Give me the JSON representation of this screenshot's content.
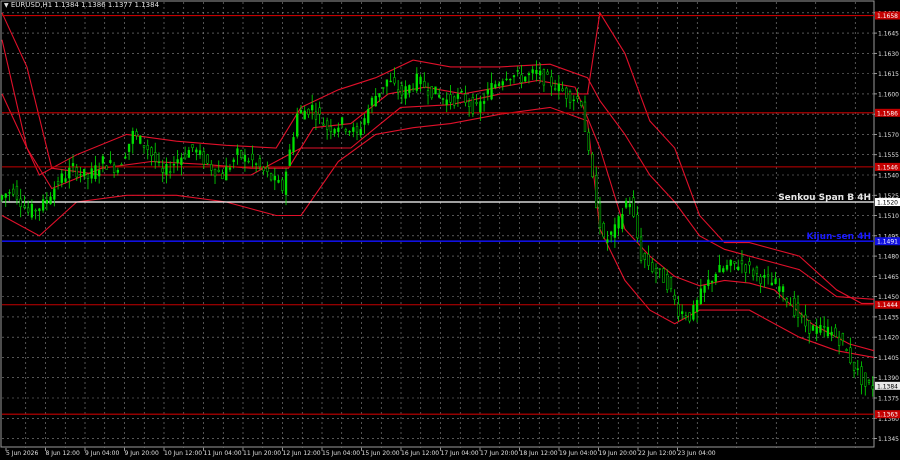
{
  "window": {
    "title": "EURUSD,H1  1.1384 1.1386 1.1377 1.1384",
    "symbol_icon": "triangle-down-icon"
  },
  "colors": {
    "background": "#000000",
    "grid": "#8a8a8a",
    "bull_candle": "#00e000",
    "bear_candle": "#00e000",
    "ichimoku_bands": "#e0102a",
    "level_red": "#c40000",
    "level_white": "#ffffff",
    "level_blue": "#1010e0",
    "axis_text": "#e0e0e0"
  },
  "chart_data": {
    "type": "candlestick",
    "symbol": "EURUSD",
    "timeframe": "H1",
    "ohlc_header": {
      "open": 1.1384,
      "high": 1.1386,
      "low": 1.1377,
      "close": 1.1384
    },
    "current_price_label": "1.1384",
    "ylim": [
      1.1338,
      1.1668
    ],
    "y_ticks": [
      "1.1345",
      "1.1360",
      "1.1375",
      "1.1390",
      "1.1405",
      "1.1420",
      "1.1435",
      "1.1450",
      "1.1465",
      "1.1480",
      "1.1495",
      "1.1510",
      "1.1525",
      "1.1540",
      "1.1555",
      "1.1570",
      "1.1585",
      "1.1600",
      "1.1615",
      "1.1630",
      "1.1645",
      "1.1660"
    ],
    "x_ticks": [
      "5 Jun 2026",
      "8 Jun 12:00",
      "9 Jun 04:00",
      "9 Jun 20:00",
      "10 Jun 12:00",
      "11 Jun 04:00",
      "11 Jun 20:00",
      "12 Jun 12:00",
      "15 Jun 04:00",
      "15 Jun 20:00",
      "16 Jun 12:00",
      "17 Jun 04:00",
      "17 Jun 20:00",
      "18 Jun 12:00",
      "19 Jun 04:00",
      "19 Jun 20:00",
      "22 Jun 12:00",
      "23 Jun 04:00"
    ],
    "levels": [
      {
        "name": "top-red-level",
        "price": 1.1658,
        "color": "red",
        "label": "1.1658"
      },
      {
        "name": "red-level-1586",
        "price": 1.1586,
        "color": "red",
        "label": "1.1586"
      },
      {
        "name": "red-level-1546",
        "price": 1.1546,
        "color": "red",
        "label": "1.1546"
      },
      {
        "name": "senkou-span-b",
        "price": 1.152,
        "color": "white",
        "label": "1.1520",
        "text": "Senkou Span B 4H"
      },
      {
        "name": "kijun-sen",
        "price": 1.1491,
        "color": "blue",
        "label": "1.1491",
        "text": "Kijun-sen 4H"
      },
      {
        "name": "red-level-1444",
        "price": 1.1444,
        "color": "red",
        "label": "1.1444"
      },
      {
        "name": "red-level-1363",
        "price": 1.1363,
        "color": "red",
        "label": "1.1363"
      }
    ],
    "price_path": [
      [
        0,
        1.1522
      ],
      [
        12,
        1.153
      ],
      [
        24,
        1.1512
      ],
      [
        36,
        1.1518
      ],
      [
        48,
        1.1535
      ],
      [
        60,
        1.1545
      ],
      [
        72,
        1.1538
      ],
      [
        84,
        1.155
      ],
      [
        96,
        1.1545
      ],
      [
        108,
        1.157
      ],
      [
        120,
        1.156
      ],
      [
        132,
        1.154
      ],
      [
        144,
        1.1552
      ],
      [
        156,
        1.156
      ],
      [
        168,
        1.1548
      ],
      [
        180,
        1.154
      ],
      [
        192,
        1.1555
      ],
      [
        204,
        1.155
      ],
      [
        216,
        1.154
      ],
      [
        228,
        1.153
      ],
      [
        240,
        1.1585
      ],
      [
        252,
        1.159
      ],
      [
        264,
        1.1575
      ],
      [
        276,
        1.1578
      ],
      [
        288,
        1.157
      ],
      [
        300,
        1.1595
      ],
      [
        312,
        1.161
      ],
      [
        324,
        1.16
      ],
      [
        336,
        1.161
      ],
      [
        348,
        1.1602
      ],
      [
        360,
        1.1595
      ],
      [
        372,
        1.1598
      ],
      [
        384,
        1.1588
      ],
      [
        396,
        1.1605
      ],
      [
        408,
        1.1615
      ],
      [
        420,
        1.1612
      ],
      [
        432,
        1.1615
      ],
      [
        444,
        1.1608
      ],
      [
        456,
        1.16
      ],
      [
        468,
        1.1595
      ],
      [
        476,
        1.154
      ],
      [
        486,
        1.149
      ],
      [
        496,
        1.15
      ],
      [
        506,
        1.1525
      ],
      [
        516,
        1.148
      ],
      [
        526,
        1.147
      ],
      [
        536,
        1.1462
      ],
      [
        546,
        1.144
      ],
      [
        556,
        1.1435
      ],
      [
        566,
        1.1455
      ],
      [
        576,
        1.1468
      ],
      [
        586,
        1.1472
      ],
      [
        596,
        1.1475
      ],
      [
        606,
        1.1468
      ],
      [
        616,
        1.1462
      ],
      [
        626,
        1.1458
      ],
      [
        636,
        1.1445
      ],
      [
        646,
        1.143
      ],
      [
        656,
        1.1425
      ],
      [
        666,
        1.1425
      ],
      [
        676,
        1.1418
      ],
      [
        686,
        1.14
      ],
      [
        696,
        1.1384
      ]
    ],
    "bb_upper": [
      [
        0,
        1.16
      ],
      [
        30,
        1.154
      ],
      [
        60,
        1.1555
      ],
      [
        100,
        1.157
      ],
      [
        140,
        1.1565
      ],
      [
        180,
        1.1562
      ],
      [
        220,
        1.156
      ],
      [
        240,
        1.159
      ],
      [
        270,
        1.1603
      ],
      [
        300,
        1.1612
      ],
      [
        330,
        1.1625
      ],
      [
        360,
        1.162
      ],
      [
        400,
        1.162
      ],
      [
        440,
        1.1622
      ],
      [
        470,
        1.1612
      ],
      [
        480,
        1.1595
      ],
      [
        500,
        1.157
      ],
      [
        520,
        1.154
      ],
      [
        540,
        1.152
      ],
      [
        560,
        1.1495
      ],
      [
        580,
        1.1485
      ],
      [
        600,
        1.148
      ],
      [
        640,
        1.147
      ],
      [
        670,
        1.145
      ],
      [
        700,
        1.1448
      ]
    ],
    "bb_lower": [
      [
        0,
        1.151
      ],
      [
        30,
        1.1495
      ],
      [
        60,
        1.152
      ],
      [
        100,
        1.1525
      ],
      [
        140,
        1.1525
      ],
      [
        180,
        1.152
      ],
      [
        220,
        1.151
      ],
      [
        240,
        1.151
      ],
      [
        270,
        1.155
      ],
      [
        300,
        1.157
      ],
      [
        330,
        1.1575
      ],
      [
        360,
        1.1578
      ],
      [
        400,
        1.1585
      ],
      [
        440,
        1.159
      ],
      [
        470,
        1.158
      ],
      [
        480,
        1.15
      ],
      [
        500,
        1.1462
      ],
      [
        520,
        1.144
      ],
      [
        540,
        1.143
      ],
      [
        560,
        1.144
      ],
      [
        580,
        1.144
      ],
      [
        600,
        1.144
      ],
      [
        640,
        1.142
      ],
      [
        670,
        1.141
      ],
      [
        700,
        1.1405
      ]
    ],
    "tenkan": [
      [
        0,
        1.164
      ],
      [
        20,
        1.156
      ],
      [
        40,
        1.153
      ],
      [
        80,
        1.1545
      ],
      [
        120,
        1.155
      ],
      [
        160,
        1.1548
      ],
      [
        200,
        1.1545
      ],
      [
        230,
        1.1545
      ],
      [
        250,
        1.1575
      ],
      [
        280,
        1.1578
      ],
      [
        310,
        1.16
      ],
      [
        340,
        1.1605
      ],
      [
        370,
        1.16
      ],
      [
        400,
        1.1605
      ],
      [
        430,
        1.161
      ],
      [
        460,
        1.1605
      ],
      [
        480,
        1.156
      ],
      [
        500,
        1.15
      ],
      [
        520,
        1.148
      ],
      [
        540,
        1.1465
      ],
      [
        560,
        1.1458
      ],
      [
        580,
        1.1462
      ],
      [
        600,
        1.146
      ],
      [
        620,
        1.1455
      ],
      [
        650,
        1.143
      ],
      [
        680,
        1.1415
      ],
      [
        700,
        1.141
      ]
    ],
    "kijun_line": [
      [
        0,
        1.166
      ],
      [
        20,
        1.162
      ],
      [
        40,
        1.1545
      ],
      [
        80,
        1.154
      ],
      [
        140,
        1.154
      ],
      [
        200,
        1.154
      ],
      [
        240,
        1.156
      ],
      [
        280,
        1.156
      ],
      [
        320,
        1.159
      ],
      [
        360,
        1.1592
      ],
      [
        400,
        1.16
      ],
      [
        450,
        1.16
      ],
      [
        470,
        1.16
      ],
      [
        480,
        1.166
      ],
      [
        500,
        1.163
      ],
      [
        520,
        1.158
      ],
      [
        540,
        1.156
      ],
      [
        560,
        1.151
      ],
      [
        580,
        1.149
      ],
      [
        600,
        1.149
      ],
      [
        640,
        1.148
      ],
      [
        670,
        1.1455
      ],
      [
        690,
        1.1445
      ],
      [
        700,
        1.1445
      ]
    ]
  }
}
